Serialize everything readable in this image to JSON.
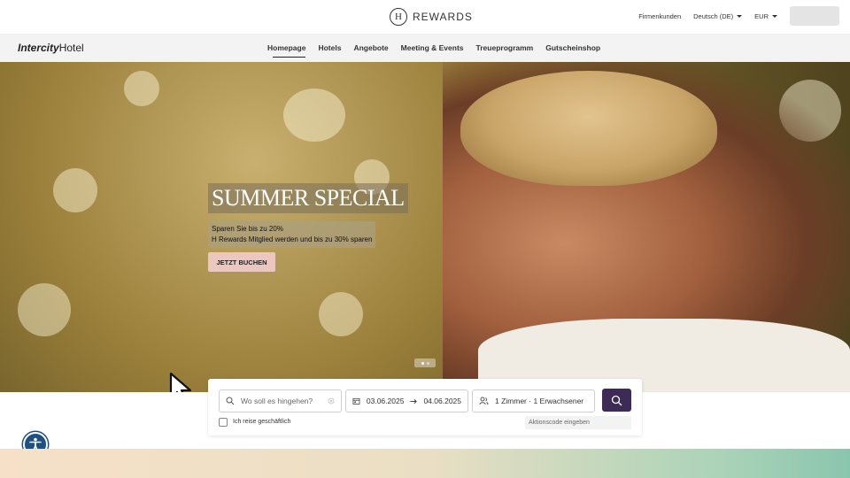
{
  "topbar": {
    "logo_text": "REWARDS",
    "logo_mark": "H",
    "links": [
      "Firmenkunden"
    ],
    "language": "Deutsch (DE)",
    "currency": "EUR"
  },
  "navbar": {
    "brand_bold": "Intercity",
    "brand_regular": "Hotel",
    "items": [
      {
        "label": "Homepage",
        "active": true
      },
      {
        "label": "Hotels",
        "active": false
      },
      {
        "label": "Angebote",
        "active": false
      },
      {
        "label": "Meeting & Events",
        "active": false
      },
      {
        "label": "Treueprogramm",
        "active": false
      },
      {
        "label": "Gutscheinshop",
        "active": false
      }
    ]
  },
  "hero": {
    "headline": "SUMMER SPECIAL",
    "line1": "Sparen Sie bis zu 20%",
    "line2": "H Rewards Mitglied werden und bis zu 30% sparen",
    "cta": "JETZT BUCHEN",
    "slides": 2,
    "active_slide": 1
  },
  "booking": {
    "destination_placeholder": "Wo soll es hingehen?",
    "date_from": "03.06.2025",
    "date_to": "04.06.2025",
    "rooms_guests": "1 Zimmer · 1 Erwachsener",
    "business_travel_label": "Ich reise geschäftlich",
    "business_travel_checked": false,
    "promo_placeholder": "Aktionscode eingeben"
  },
  "colors": {
    "search_button": "#3d2a56",
    "cta_button": "#ecc7c0",
    "accessibility": "#1f4f83"
  },
  "icons": {
    "search": "search-icon",
    "calendar": "calendar-icon",
    "guests": "guests-icon",
    "accessibility": "accessibility-icon"
  }
}
